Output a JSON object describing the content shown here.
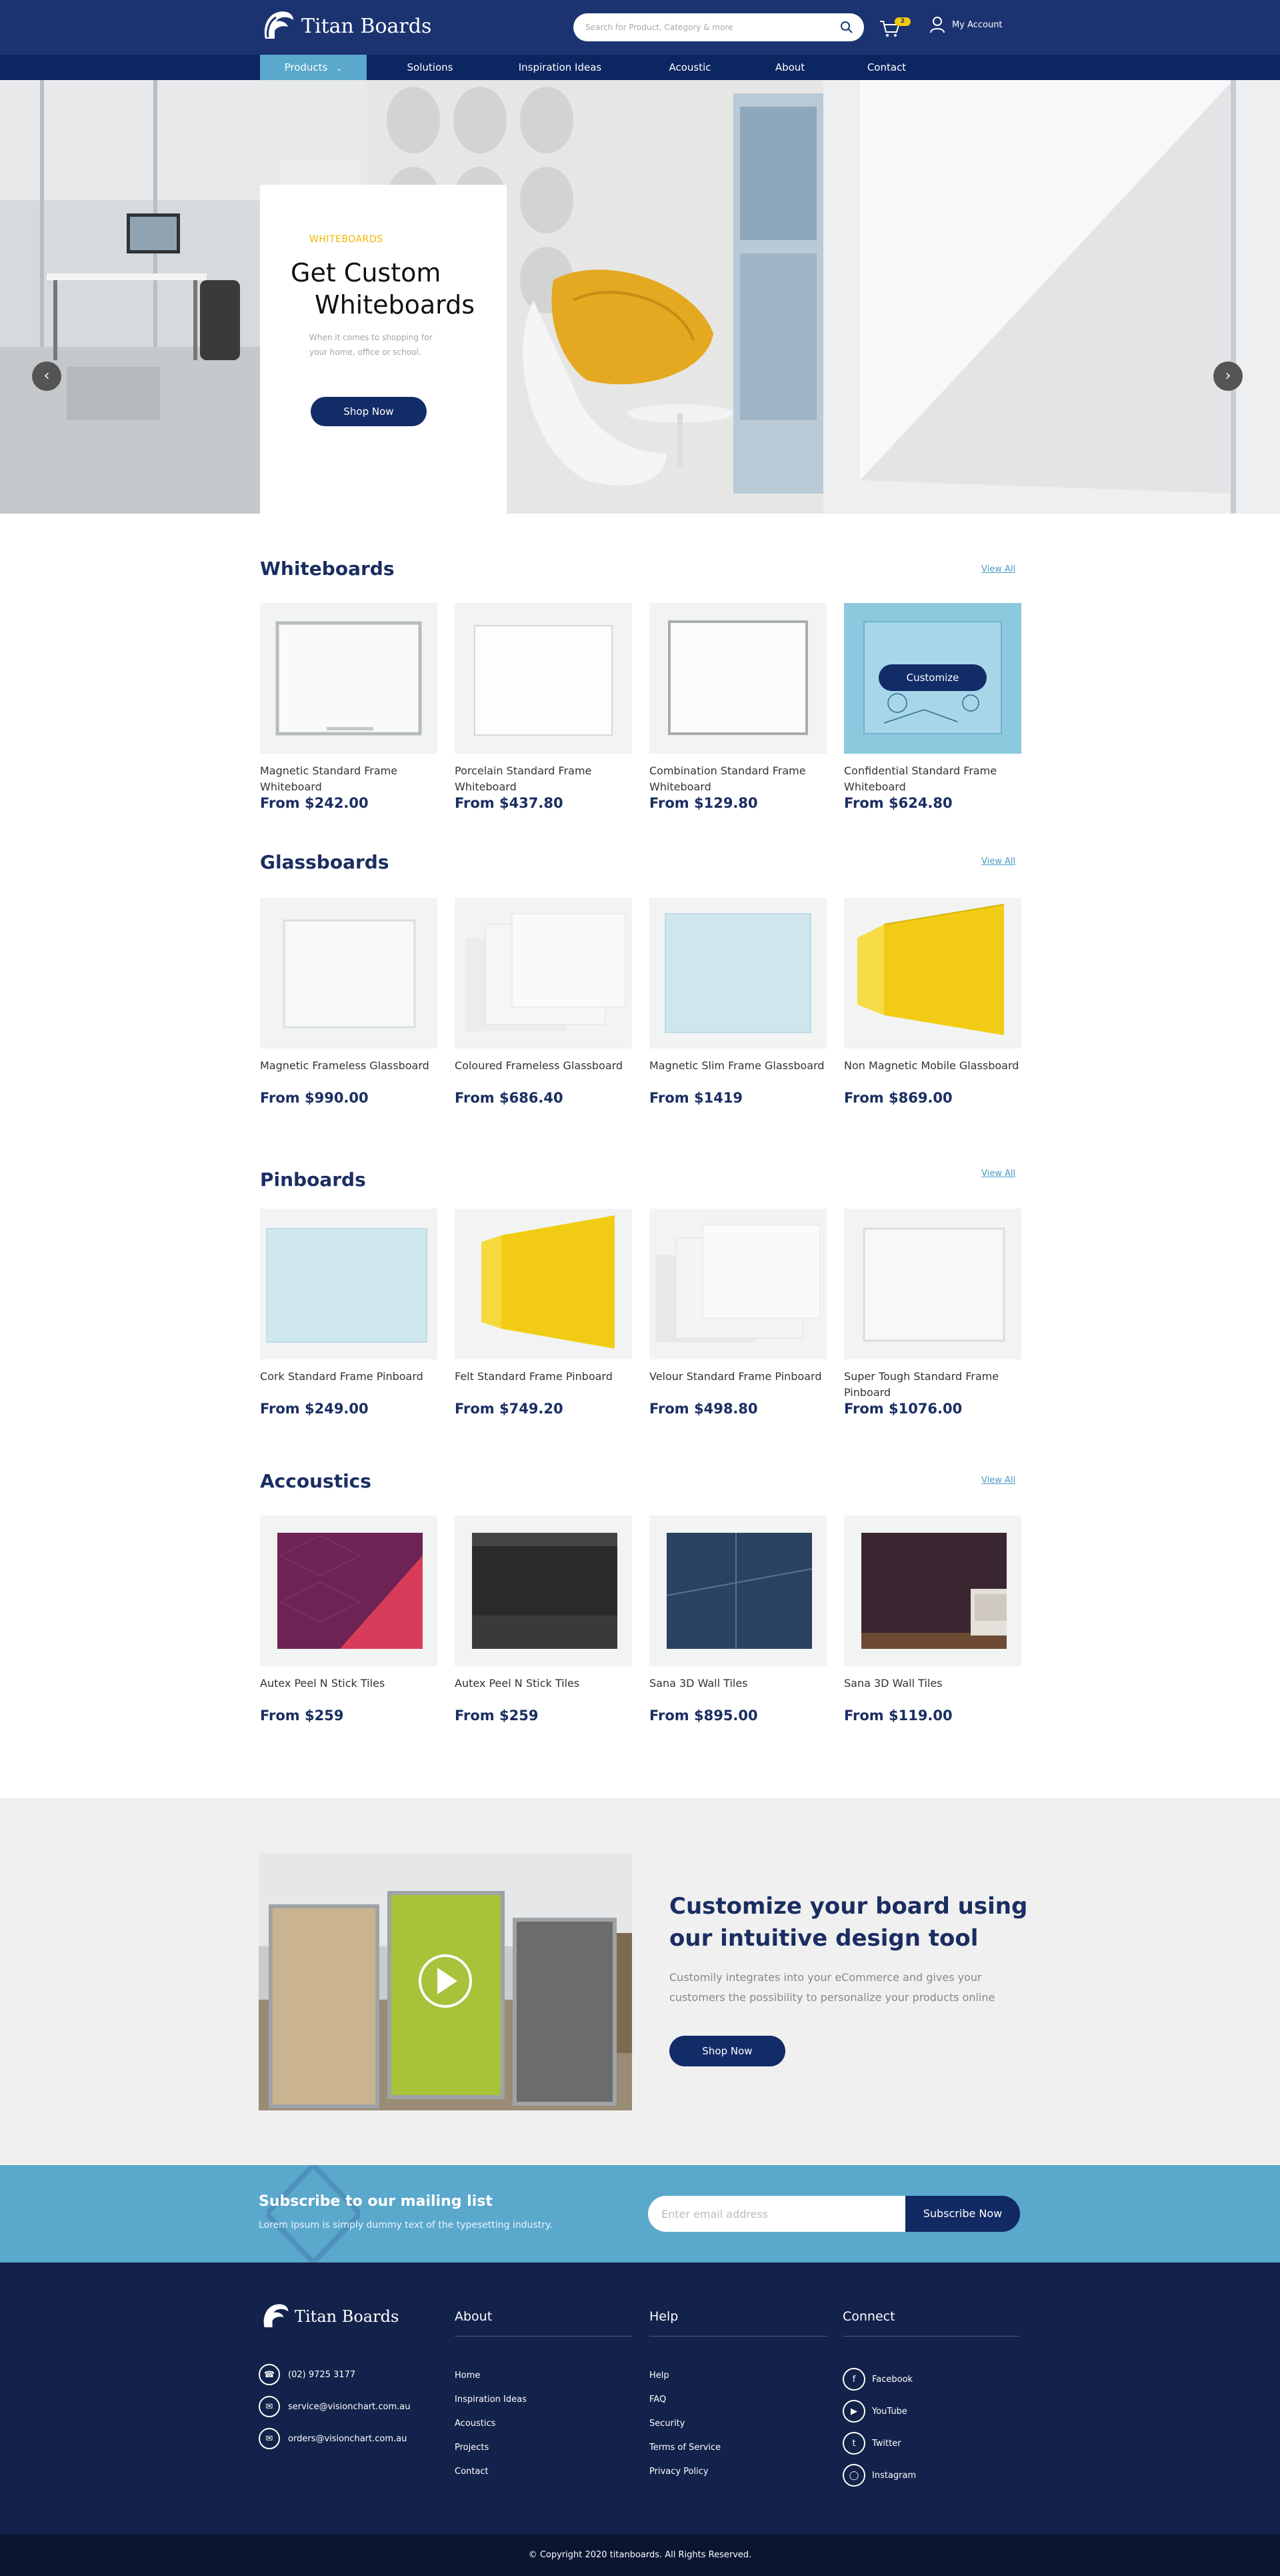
{
  "brand": {
    "name": "Titan Boards"
  },
  "header": {
    "search_placeholder": "Search for Product, Category & more",
    "cart_count": "2",
    "account_label": "My Account"
  },
  "nav": {
    "items": [
      "Products",
      "Solutions",
      "Inspiration Ideas",
      "Acoustic",
      "About",
      "Contact"
    ]
  },
  "hero": {
    "kicker": "WHITEBOARDS",
    "title_line1": "Get Custom",
    "title_line2": "Whiteboards",
    "subtitle": "When it comes to shopping for your home, office or school.",
    "button": "Shop Now"
  },
  "sections": [
    {
      "title": "Whiteboards",
      "view_all": "View All",
      "products": [
        {
          "name": "Magnetic Standard Frame Whiteboard",
          "price": "From $242.00"
        },
        {
          "name": "Porcelain Standard Frame Whiteboard",
          "price": "From $437.80"
        },
        {
          "name": "Combination Standard Frame Whiteboard",
          "price": "From $129.80"
        },
        {
          "name": "Confidential Standard Frame Whiteboard",
          "price": "From $624.80",
          "overlay": "Customize"
        }
      ]
    },
    {
      "title": "Glassboards",
      "view_all": "View All",
      "products": [
        {
          "name": "Magnetic Frameless Glassboard",
          "price": "From $990.00"
        },
        {
          "name": "Coloured Frameless Glassboard",
          "price": "From $686.40"
        },
        {
          "name": "Magnetic Slim Frame Glassboard",
          "price": "From $1419"
        },
        {
          "name": "Non Magnetic Mobile Glassboard",
          "price": "From $869.00"
        }
      ]
    },
    {
      "title": "Pinboards",
      "view_all": "View All",
      "products": [
        {
          "name": "Cork Standard Frame Pinboard",
          "price": "From $249.00"
        },
        {
          "name": "Felt Standard Frame Pinboard",
          "price": "From $749.20"
        },
        {
          "name": "Velour Standard Frame Pinboard",
          "price": "From $498.80"
        },
        {
          "name": "Super Tough Standard Frame Pinboard",
          "price": "From $1076.00"
        }
      ]
    },
    {
      "title": "Accoustics",
      "view_all": "View All",
      "products": [
        {
          "name": "Autex Peel N Stick Tiles",
          "price": "From $259"
        },
        {
          "name": "Autex Peel N Stick Tiles",
          "price": "From $259"
        },
        {
          "name": "Sana 3D Wall Tiles",
          "price": "From $895.00"
        },
        {
          "name": "Sana 3D Wall Tiles",
          "price": "From $119.00"
        }
      ]
    }
  ],
  "promo": {
    "title": "Customize your board using our intuitive design tool",
    "text": "Customily integrates into your eCommerce and gives your customers the possibility to personalize your products online",
    "button": "Shop Now"
  },
  "subscribe": {
    "title": "Subscribe to our mailing list",
    "text": "Lorem Ipsum is simply dummy text of the typesetting industry.",
    "placeholder": "Enter email address",
    "button": "Subscribe Now"
  },
  "footer": {
    "phone": "(02) 9725 3177",
    "email1": "service@visionchart.com.au",
    "email2": "orders@visionchart.com.au",
    "about": {
      "title": "About",
      "links": [
        "Home",
        "Inspiration Ideas",
        "Acoustics",
        "Projects",
        "Contact"
      ]
    },
    "help": {
      "title": "Help",
      "links": [
        "Help",
        "FAQ",
        "Security",
        "Terms of Service",
        "Privacy Policy"
      ]
    },
    "connect": {
      "title": "Connect",
      "links": [
        "Facebook",
        "YouTube",
        "Twitter",
        "Instagram"
      ]
    },
    "copyright": "© Copyright 2020 titanboards. All Rights Reserved."
  }
}
